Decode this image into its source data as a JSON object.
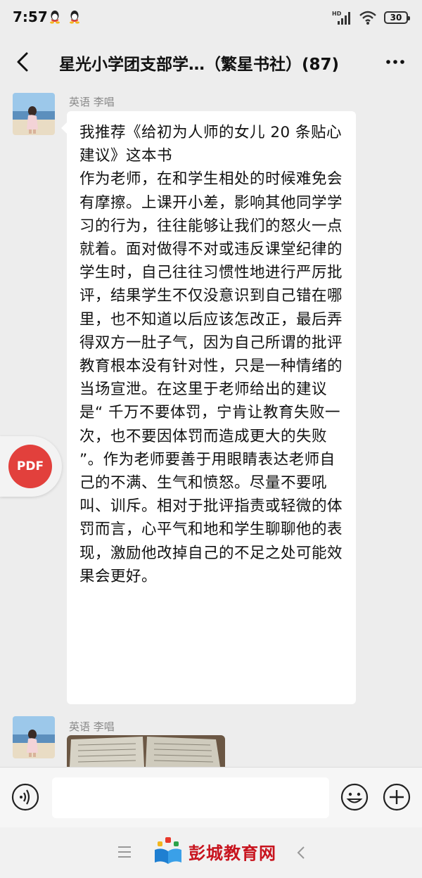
{
  "status_bar": {
    "time": "7:57",
    "left_icons": [
      "qq-icon",
      "qq-icon"
    ],
    "network": "HD",
    "battery": "30"
  },
  "header": {
    "title": "星光小学团支部学…（繁星书社）(87)",
    "back_icon": "chevron-left-icon",
    "more_icon": "more-horizontal-icon"
  },
  "messages": [
    {
      "sender": "英语 李唱",
      "type": "text",
      "paragraphs": [
        "我推荐《给初为人师的女儿 20 条贴心建议》这本书",
        "作为老师，在和学生相处的时候难免会有摩擦。上课开小差，影响其他同学学习的行为，往往能够让我们的怒火一点就着。面对做得不对或违反课堂纪律的学生时，自己往往习惯性地进行严厉批评，结果学生不仅没意识到自己错在哪里，也不知道以后应该怎改正，最后弄得双方一肚子气，因为自己所谓的批评教育根本没有针对性，只是一种情绪的当场宣泄。在这里于老师给出的建议是“ 千万不要体罚，宁肯让教育失败一次，也不要因体罚而造成更大的失败 ”。作为老师要善于用眼睛表达老师自己的不满、生气和愤怒。尽量不要吼叫、训斥。相对于批评指责或轻微的体罚而言，心平气和地和学生聊聊他的表现，激励他改掉自己的不足之处可能效果会更好。"
      ]
    },
    {
      "sender": "英语 李唱",
      "type": "image"
    }
  ],
  "floating": {
    "pdf_label": "PDF"
  },
  "input_bar": {
    "placeholder": "",
    "icons": [
      "voice-icon",
      "emoji-icon",
      "plus-icon"
    ]
  },
  "nav_bar": {
    "watermark": "彭城教育网",
    "icons": [
      "menu-icon",
      "back-icon"
    ]
  },
  "colors": {
    "background": "#ededed",
    "bubble": "#ffffff",
    "pdf": "#e2403c",
    "watermark": "#c8141e"
  }
}
